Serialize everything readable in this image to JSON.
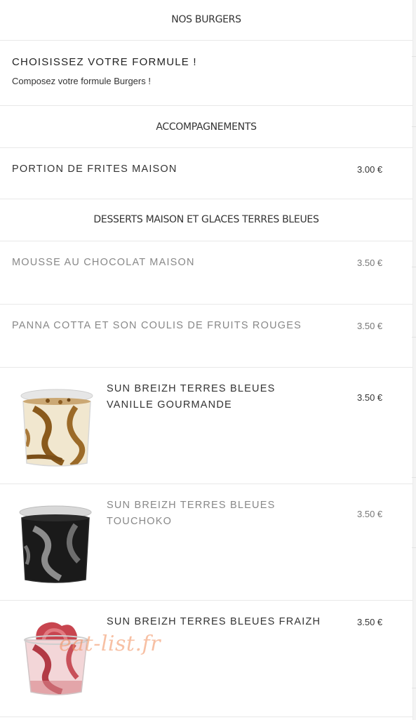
{
  "sections": {
    "burgers": "NOS BURGERS",
    "sides": "ACCOMPAGNEMENTS",
    "desserts": "DESSERTS MAISON ET GLACES TERRES BLEUES"
  },
  "formula": {
    "title": "CHOISISSEZ VOTRE FORMULE !",
    "subtitle": "Composez votre formule Burgers !"
  },
  "items": [
    {
      "name": "PORTION DE FRITES MAISON",
      "price": "3.00 €"
    },
    {
      "name": "MOUSSE AU CHOCOLAT MAISON",
      "price": "3.50 €"
    },
    {
      "name": "PANNA COTTA ET SON COULIS DE FRUITS ROUGES",
      "price": "3.50 €"
    },
    {
      "name_line1": "SUN BREIZH TERRES BLEUES",
      "name_line2": "VANILLE GOURMANDE",
      "price": "3.50 €"
    },
    {
      "name_line1": "SUN BREIZH TERRES BLEUES",
      "name_line2": "TOUCHOKO",
      "price": "3.50 €"
    },
    {
      "name": "SUN BREIZH TERRES BLEUES FRAIZH",
      "price": "3.50 €"
    }
  ],
  "watermark": "eat-list.fr"
}
